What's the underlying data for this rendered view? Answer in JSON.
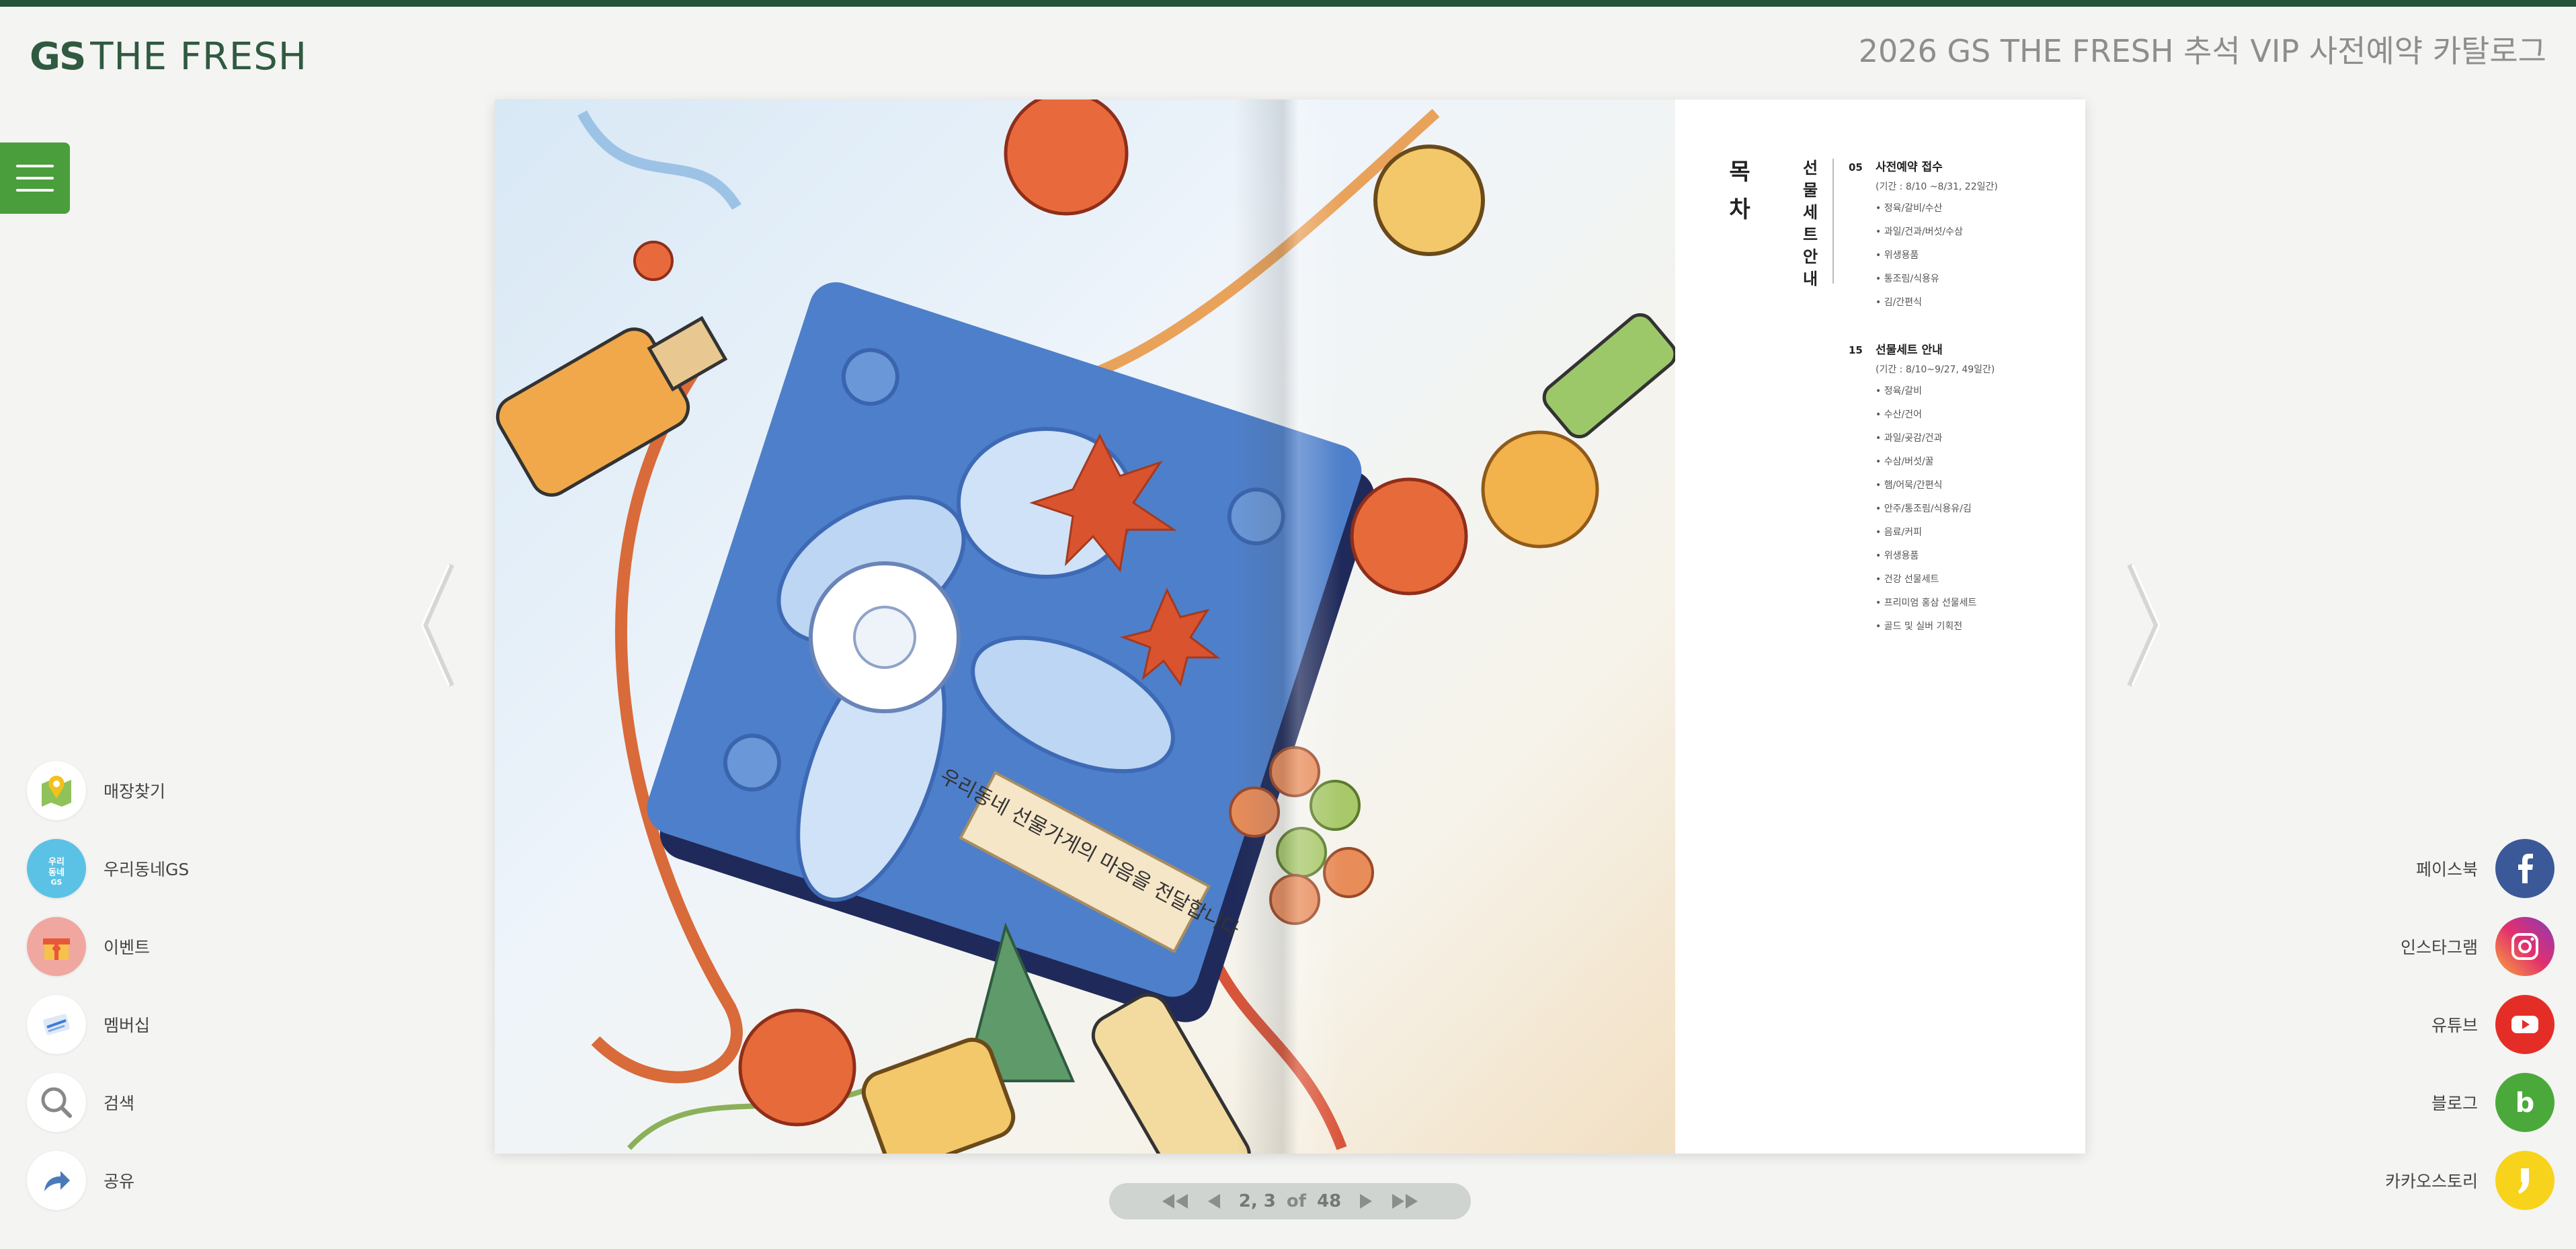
{
  "header": {
    "logo_gs": "GS",
    "logo_rest": "THE FRESH",
    "catalog_title": "2026 GS THE FRESH 추석 VIP 사전예약 카탈로그"
  },
  "colors": {
    "brand_green": "#2f5a40",
    "menu_green": "#4a9e3c",
    "facebook": "#3b5998",
    "youtube": "#e52d27",
    "blog": "#4aa93a",
    "kakaostory": "#f7d31c"
  },
  "toc": {
    "title": "목차",
    "subtitle": "선물세트안내",
    "sections": [
      {
        "num": "05",
        "name": "사전예약 접수",
        "period": "(기간 : 8/10 ~8/31, 22일간)",
        "items": [
          "• 정육/갈비/수산",
          "• 과일/건과/버섯/수삼",
          "• 위생용품",
          "• 통조림/식용유",
          "• 김/간편식"
        ]
      },
      {
        "num": "15",
        "name": "선물세트 안내",
        "period": "(기간 : 8/10~9/27, 49일간)",
        "items": [
          "• 정육/갈비",
          "• 수산/건어",
          "• 과일/곶감/건과",
          "• 수삼/버섯/꿀",
          "• 햄/어묵/간편식",
          "• 안주/통조림/식용유/김",
          "• 음료/커피",
          "• 위생용품",
          "• 건강 선물세트",
          "• 프리미엄 홍삼 선물세트",
          "• 골드 및 실버 기획전"
        ]
      }
    ]
  },
  "illustration": {
    "tag_text": "우리동네 선물가게의 마음을 전달합니다"
  },
  "pager": {
    "current": "2, 3",
    "of_label": "of",
    "total": "48"
  },
  "left_menu": [
    {
      "label": "매장찾기",
      "icon": "map-pin-icon"
    },
    {
      "label": "우리동네GS",
      "icon": "woori-gs-icon"
    },
    {
      "label": "이벤트",
      "icon": "gift-icon"
    },
    {
      "label": "멤버십",
      "icon": "membership-card-icon"
    },
    {
      "label": "검색",
      "icon": "search-icon"
    },
    {
      "label": "공유",
      "icon": "share-icon"
    }
  ],
  "social": [
    {
      "label": "페이스북",
      "icon": "facebook-icon"
    },
    {
      "label": "인스타그램",
      "icon": "instagram-icon"
    },
    {
      "label": "유튜브",
      "icon": "youtube-icon"
    },
    {
      "label": "블로그",
      "icon": "blog-icon"
    },
    {
      "label": "카카오스토리",
      "icon": "kakaostory-icon"
    }
  ]
}
